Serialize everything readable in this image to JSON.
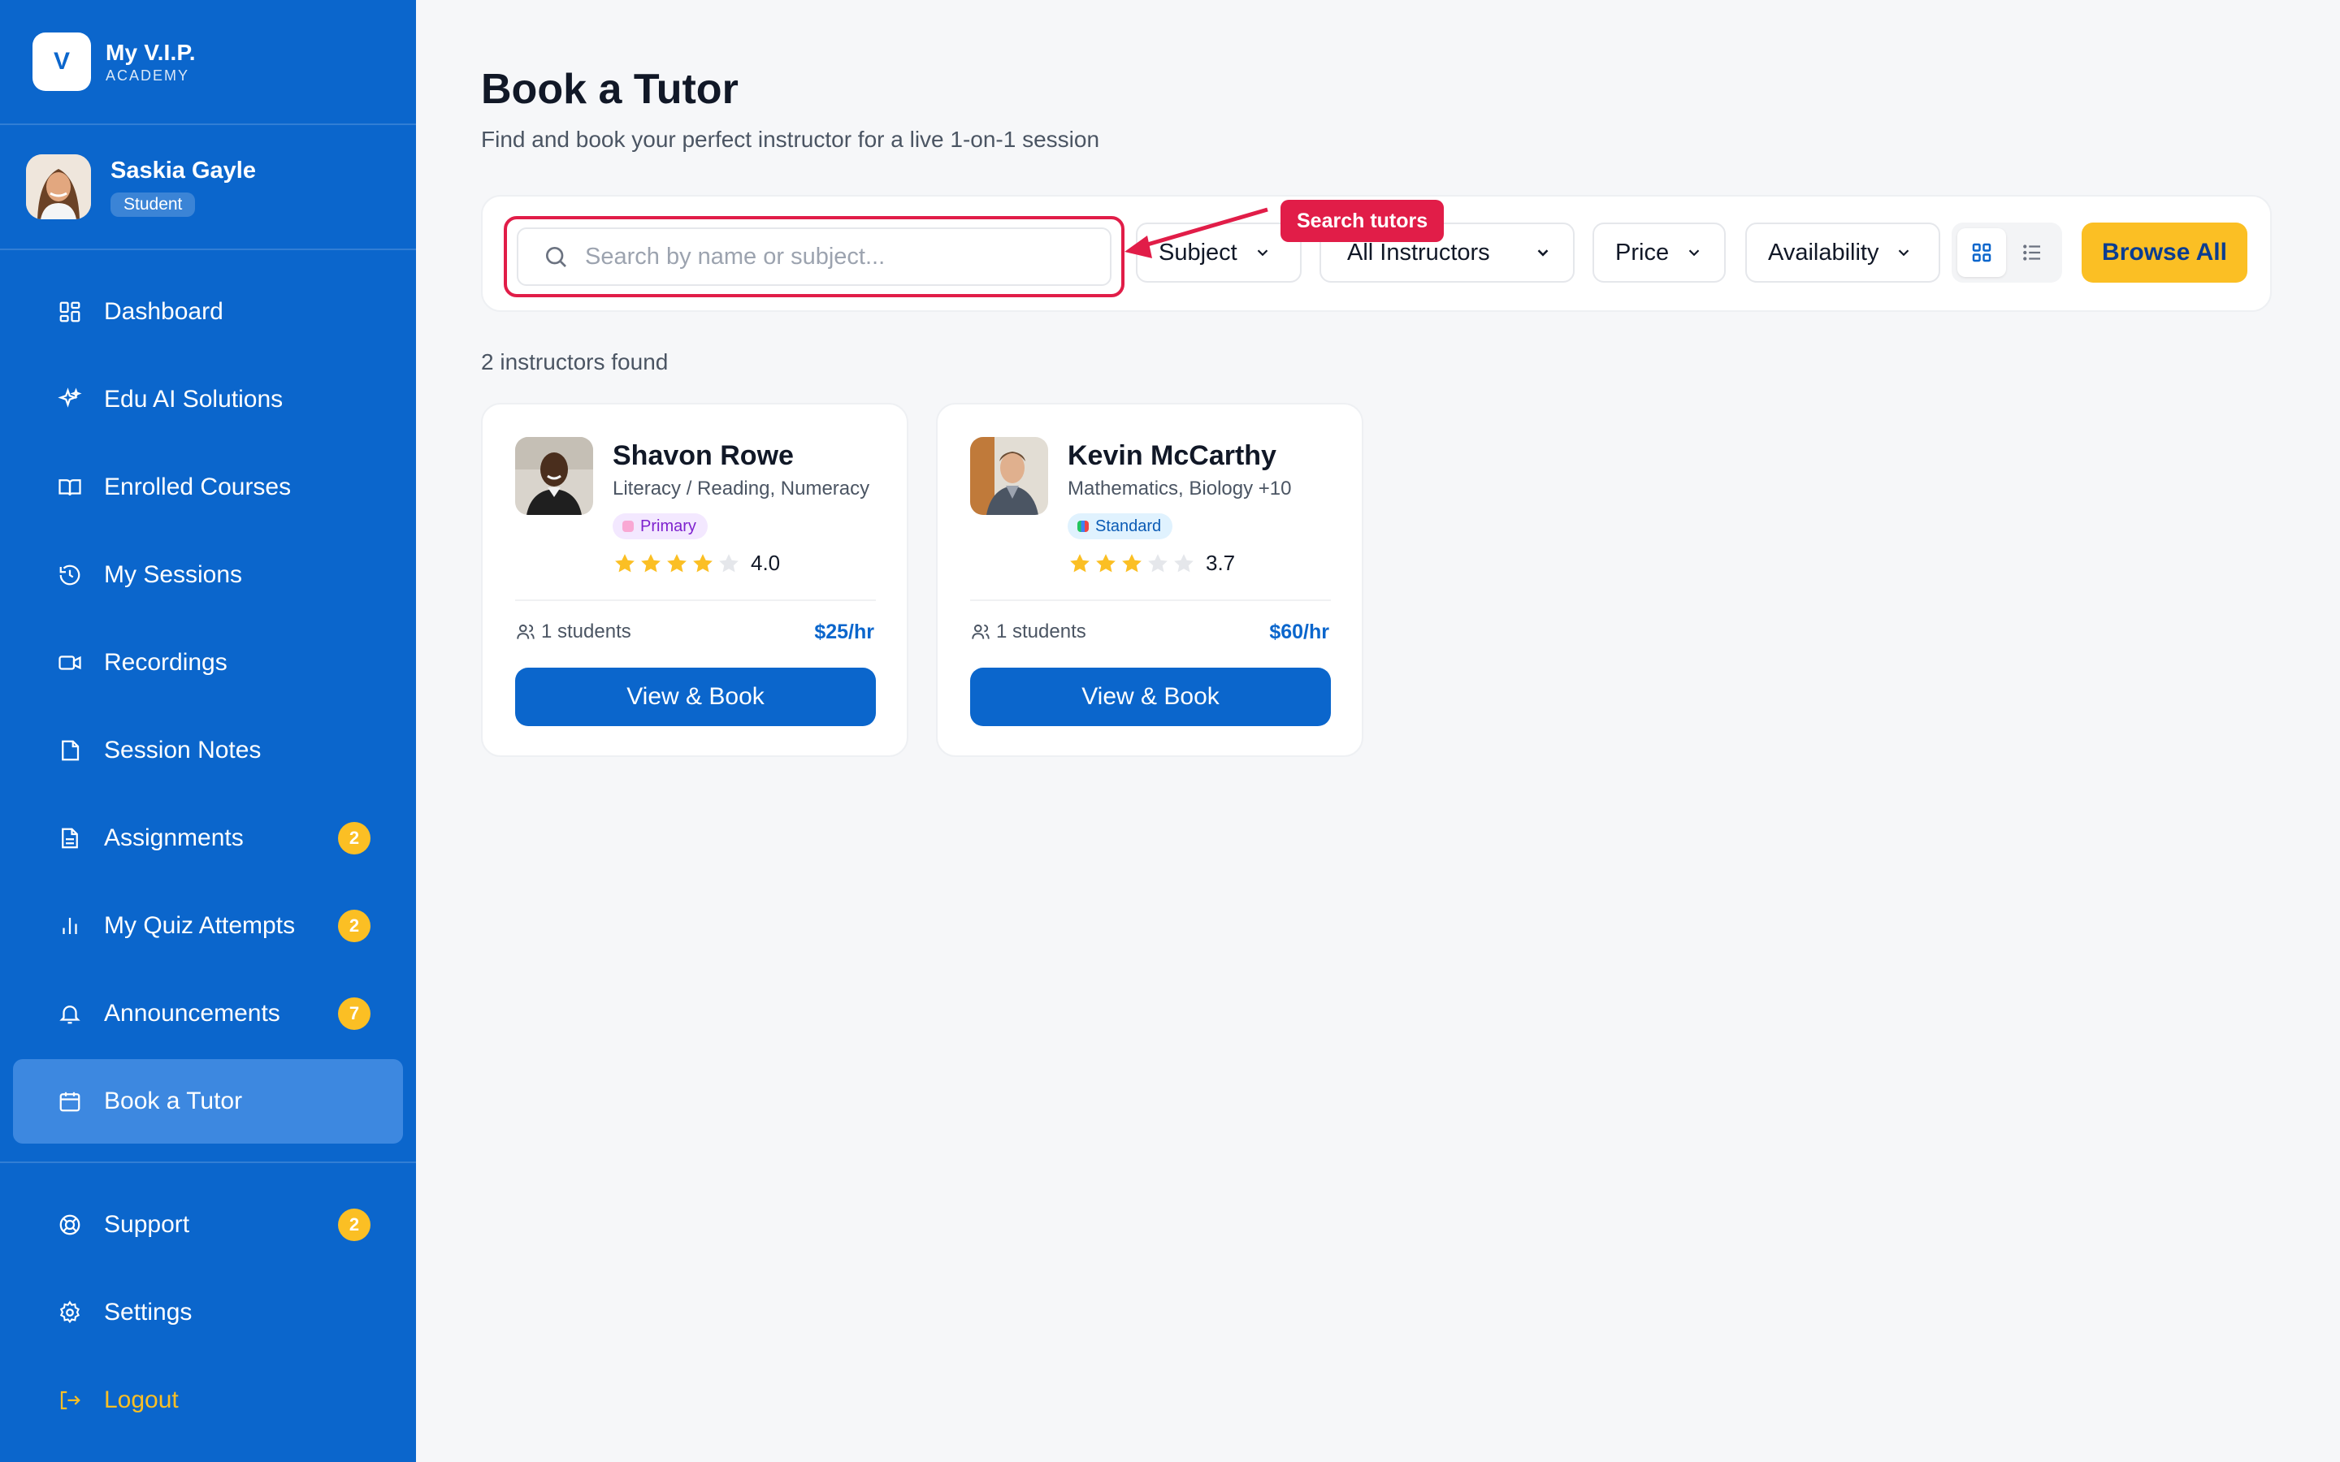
{
  "brand": {
    "logo_letter": "V",
    "name": "My V.I.P.",
    "sub": "ACADEMY"
  },
  "user": {
    "name": "Saskia Gayle",
    "role": "Student"
  },
  "nav": [
    {
      "label": "Dashboard",
      "icon": "dashboard-icon"
    },
    {
      "label": "Edu AI Solutions",
      "icon": "sparkle-icon"
    },
    {
      "label": "Enrolled Courses",
      "icon": "book-open-icon"
    },
    {
      "label": "My Sessions",
      "icon": "history-icon"
    },
    {
      "label": "Recordings",
      "icon": "video-icon"
    },
    {
      "label": "Session Notes",
      "icon": "note-icon"
    },
    {
      "label": "Assignments",
      "icon": "document-icon",
      "badge": "2"
    },
    {
      "label": "My Quiz Attempts",
      "icon": "bar-chart-icon",
      "badge": "2"
    },
    {
      "label": "Announcements",
      "icon": "bell-icon",
      "badge": "7"
    },
    {
      "label": "Book a Tutor",
      "icon": "calendar-icon",
      "active": true
    }
  ],
  "nav_bottom": [
    {
      "label": "Support",
      "icon": "lifebuoy-icon",
      "badge": "2"
    },
    {
      "label": "Settings",
      "icon": "gear-icon"
    },
    {
      "label": "Logout",
      "icon": "logout-icon"
    }
  ],
  "page": {
    "title": "Book a Tutor",
    "subtitle": "Find and book your perfect instructor for a live 1-on-1 session"
  },
  "filters": {
    "search_placeholder": "Search by name or subject...",
    "subject": "Subject",
    "instructors": "All Instructors",
    "price": "Price",
    "availability": "Availability",
    "browse_all": "Browse All"
  },
  "callout": "Search tutors",
  "results_count": "2 instructors found",
  "instructors": [
    {
      "name": "Shavon Rowe",
      "subjects": "Literacy / Reading, Numeracy",
      "tag": "Primary",
      "rating": 4.0,
      "rating_label": "4.0",
      "students": "1 students",
      "price": "$25/hr",
      "button": "View & Book"
    },
    {
      "name": "Kevin McCarthy",
      "subjects": "Mathematics, Biology +10",
      "tag": "Standard",
      "rating": 3.7,
      "rating_label": "3.7",
      "students": "1 students",
      "price": "$60/hr",
      "button": "View & Book"
    }
  ],
  "colors": {
    "sidebar": "#0b66cc",
    "accent_yellow": "#fbbf24",
    "highlight_red": "#e11d48",
    "star": "#fbbf24"
  }
}
